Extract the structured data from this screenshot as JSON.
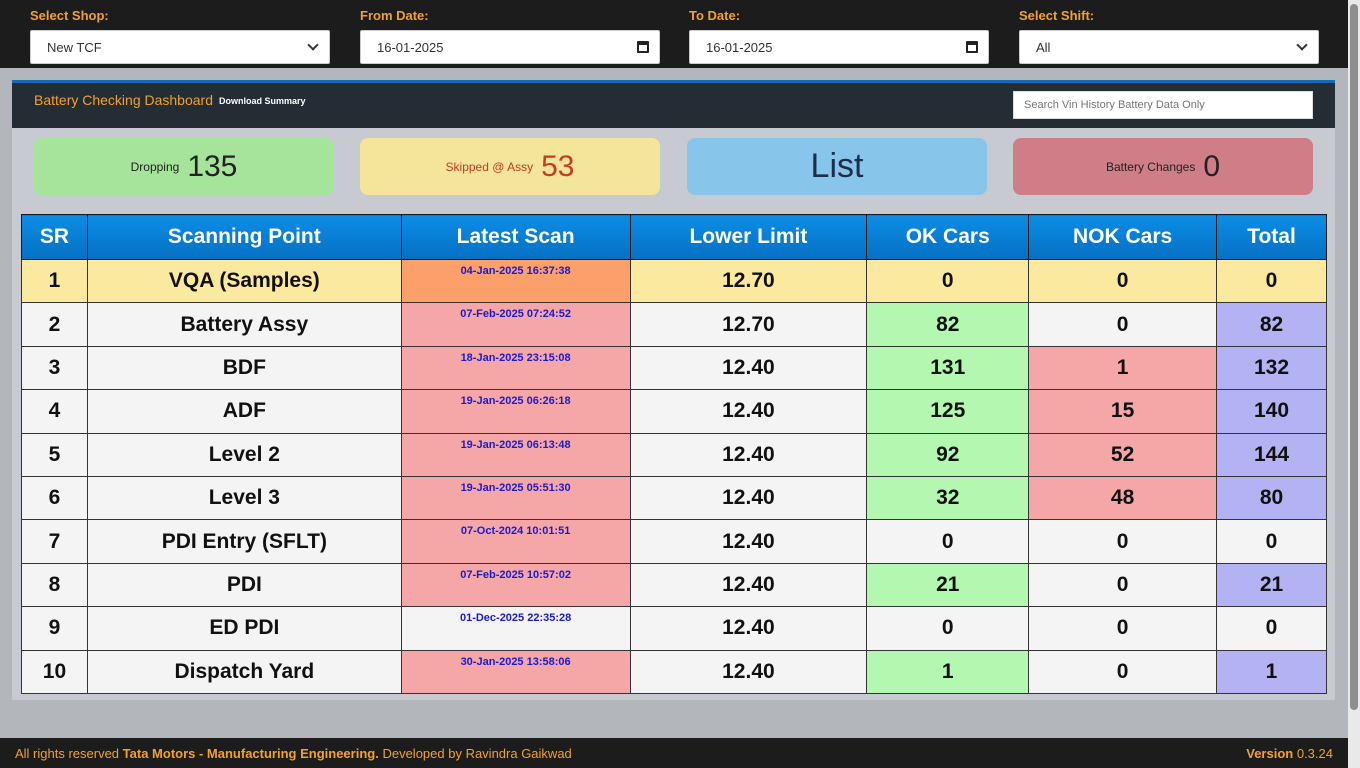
{
  "filters": {
    "shop": {
      "label": "Select Shop:",
      "value": "New TCF"
    },
    "from_date": {
      "label": "From Date:",
      "value": "16-01-2025"
    },
    "to_date": {
      "label": "To Date:",
      "value": "16-01-2025"
    },
    "shift": {
      "label": "Select Shift:",
      "value": "All"
    }
  },
  "panel": {
    "title": "Battery Checking Dashboard",
    "download_label": "Download Summary",
    "search_placeholder": "Search Vin History Battery Data Only"
  },
  "cards": {
    "dropping": {
      "label": "Dropping",
      "value": "135"
    },
    "skipped": {
      "label": "Skipped @ Assy",
      "value": "53"
    },
    "list": {
      "label": "List"
    },
    "battery_changes": {
      "label": "Battery Changes",
      "value": "0"
    }
  },
  "table": {
    "headers": [
      "SR",
      "Scanning Point",
      "Latest Scan",
      "Lower Limit",
      "OK Cars",
      "NOK Cars",
      "Total"
    ],
    "rows": [
      {
        "sr": "1",
        "point": "VQA (Samples)",
        "scan": "04-Jan-2025 16:37:38",
        "limit": "12.70",
        "ok": "0",
        "nok": "0",
        "total": "0"
      },
      {
        "sr": "2",
        "point": "Battery Assy",
        "scan": "07-Feb-2025 07:24:52",
        "limit": "12.70",
        "ok": "82",
        "nok": "0",
        "total": "82"
      },
      {
        "sr": "3",
        "point": "BDF",
        "scan": "18-Jan-2025 23:15:08",
        "limit": "12.40",
        "ok": "131",
        "nok": "1",
        "total": "132"
      },
      {
        "sr": "4",
        "point": "ADF",
        "scan": "19-Jan-2025 06:26:18",
        "limit": "12.40",
        "ok": "125",
        "nok": "15",
        "total": "140"
      },
      {
        "sr": "5",
        "point": "Level 2",
        "scan": "19-Jan-2025 06:13:48",
        "limit": "12.40",
        "ok": "92",
        "nok": "52",
        "total": "144"
      },
      {
        "sr": "6",
        "point": "Level 3",
        "scan": "19-Jan-2025 05:51:30",
        "limit": "12.40",
        "ok": "32",
        "nok": "48",
        "total": "80"
      },
      {
        "sr": "7",
        "point": "PDI Entry (SFLT)",
        "scan": "07-Oct-2024 10:01:51",
        "limit": "12.40",
        "ok": "0",
        "nok": "0",
        "total": "0"
      },
      {
        "sr": "8",
        "point": "PDI",
        "scan": "07-Feb-2025 10:57:02",
        "limit": "12.40",
        "ok": "21",
        "nok": "0",
        "total": "21"
      },
      {
        "sr": "9",
        "point": "ED PDI",
        "scan": "01-Dec-2025 22:35:28",
        "limit": "12.40",
        "ok": "0",
        "nok": "0",
        "total": "0"
      },
      {
        "sr": "10",
        "point": "Dispatch Yard",
        "scan": "30-Jan-2025 13:58:06",
        "limit": "12.40",
        "ok": "1",
        "nok": "0",
        "total": "1"
      }
    ]
  },
  "footer": {
    "prefix": "All rights reserved",
    "company": "Tata Motors - Manufacturing Engineering.",
    "developer": "Developed by Ravindra Gaikwad",
    "version_label": "Version",
    "version": "0.3.24"
  },
  "colors": {
    "accent": "#f2a22a",
    "header_blue": "#0670c2",
    "ok_green": "#b3f7b0",
    "nok_pink": "#f5a6a6",
    "total_lavender": "#b3b3f4"
  }
}
